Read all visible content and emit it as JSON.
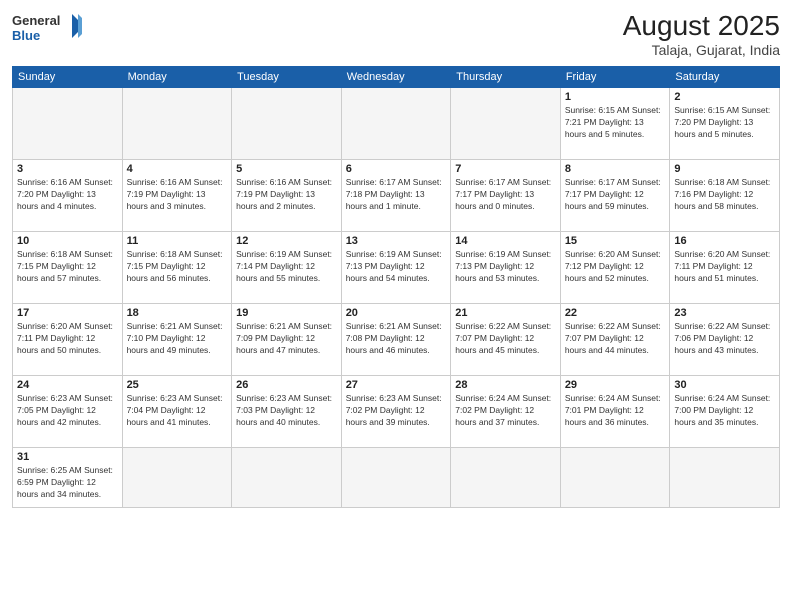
{
  "header": {
    "logo_general": "General",
    "logo_blue": "Blue",
    "month_year": "August 2025",
    "location": "Talaja, Gujarat, India"
  },
  "weekdays": [
    "Sunday",
    "Monday",
    "Tuesday",
    "Wednesday",
    "Thursday",
    "Friday",
    "Saturday"
  ],
  "weeks": [
    [
      {
        "day": "",
        "info": ""
      },
      {
        "day": "",
        "info": ""
      },
      {
        "day": "",
        "info": ""
      },
      {
        "day": "",
        "info": ""
      },
      {
        "day": "",
        "info": ""
      },
      {
        "day": "1",
        "info": "Sunrise: 6:15 AM\nSunset: 7:21 PM\nDaylight: 13 hours\nand 5 minutes."
      },
      {
        "day": "2",
        "info": "Sunrise: 6:15 AM\nSunset: 7:20 PM\nDaylight: 13 hours\nand 5 minutes."
      }
    ],
    [
      {
        "day": "3",
        "info": "Sunrise: 6:16 AM\nSunset: 7:20 PM\nDaylight: 13 hours\nand 4 minutes."
      },
      {
        "day": "4",
        "info": "Sunrise: 6:16 AM\nSunset: 7:19 PM\nDaylight: 13 hours\nand 3 minutes."
      },
      {
        "day": "5",
        "info": "Sunrise: 6:16 AM\nSunset: 7:19 PM\nDaylight: 13 hours\nand 2 minutes."
      },
      {
        "day": "6",
        "info": "Sunrise: 6:17 AM\nSunset: 7:18 PM\nDaylight: 13 hours\nand 1 minute."
      },
      {
        "day": "7",
        "info": "Sunrise: 6:17 AM\nSunset: 7:17 PM\nDaylight: 13 hours\nand 0 minutes."
      },
      {
        "day": "8",
        "info": "Sunrise: 6:17 AM\nSunset: 7:17 PM\nDaylight: 12 hours\nand 59 minutes."
      },
      {
        "day": "9",
        "info": "Sunrise: 6:18 AM\nSunset: 7:16 PM\nDaylight: 12 hours\nand 58 minutes."
      }
    ],
    [
      {
        "day": "10",
        "info": "Sunrise: 6:18 AM\nSunset: 7:15 PM\nDaylight: 12 hours\nand 57 minutes."
      },
      {
        "day": "11",
        "info": "Sunrise: 6:18 AM\nSunset: 7:15 PM\nDaylight: 12 hours\nand 56 minutes."
      },
      {
        "day": "12",
        "info": "Sunrise: 6:19 AM\nSunset: 7:14 PM\nDaylight: 12 hours\nand 55 minutes."
      },
      {
        "day": "13",
        "info": "Sunrise: 6:19 AM\nSunset: 7:13 PM\nDaylight: 12 hours\nand 54 minutes."
      },
      {
        "day": "14",
        "info": "Sunrise: 6:19 AM\nSunset: 7:13 PM\nDaylight: 12 hours\nand 53 minutes."
      },
      {
        "day": "15",
        "info": "Sunrise: 6:20 AM\nSunset: 7:12 PM\nDaylight: 12 hours\nand 52 minutes."
      },
      {
        "day": "16",
        "info": "Sunrise: 6:20 AM\nSunset: 7:11 PM\nDaylight: 12 hours\nand 51 minutes."
      }
    ],
    [
      {
        "day": "17",
        "info": "Sunrise: 6:20 AM\nSunset: 7:11 PM\nDaylight: 12 hours\nand 50 minutes."
      },
      {
        "day": "18",
        "info": "Sunrise: 6:21 AM\nSunset: 7:10 PM\nDaylight: 12 hours\nand 49 minutes."
      },
      {
        "day": "19",
        "info": "Sunrise: 6:21 AM\nSunset: 7:09 PM\nDaylight: 12 hours\nand 47 minutes."
      },
      {
        "day": "20",
        "info": "Sunrise: 6:21 AM\nSunset: 7:08 PM\nDaylight: 12 hours\nand 46 minutes."
      },
      {
        "day": "21",
        "info": "Sunrise: 6:22 AM\nSunset: 7:07 PM\nDaylight: 12 hours\nand 45 minutes."
      },
      {
        "day": "22",
        "info": "Sunrise: 6:22 AM\nSunset: 7:07 PM\nDaylight: 12 hours\nand 44 minutes."
      },
      {
        "day": "23",
        "info": "Sunrise: 6:22 AM\nSunset: 7:06 PM\nDaylight: 12 hours\nand 43 minutes."
      }
    ],
    [
      {
        "day": "24",
        "info": "Sunrise: 6:23 AM\nSunset: 7:05 PM\nDaylight: 12 hours\nand 42 minutes."
      },
      {
        "day": "25",
        "info": "Sunrise: 6:23 AM\nSunset: 7:04 PM\nDaylight: 12 hours\nand 41 minutes."
      },
      {
        "day": "26",
        "info": "Sunrise: 6:23 AM\nSunset: 7:03 PM\nDaylight: 12 hours\nand 40 minutes."
      },
      {
        "day": "27",
        "info": "Sunrise: 6:23 AM\nSunset: 7:02 PM\nDaylight: 12 hours\nand 39 minutes."
      },
      {
        "day": "28",
        "info": "Sunrise: 6:24 AM\nSunset: 7:02 PM\nDaylight: 12 hours\nand 37 minutes."
      },
      {
        "day": "29",
        "info": "Sunrise: 6:24 AM\nSunset: 7:01 PM\nDaylight: 12 hours\nand 36 minutes."
      },
      {
        "day": "30",
        "info": "Sunrise: 6:24 AM\nSunset: 7:00 PM\nDaylight: 12 hours\nand 35 minutes."
      }
    ],
    [
      {
        "day": "31",
        "info": "Sunrise: 6:25 AM\nSunset: 6:59 PM\nDaylight: 12 hours\nand 34 minutes."
      },
      {
        "day": "",
        "info": ""
      },
      {
        "day": "",
        "info": ""
      },
      {
        "day": "",
        "info": ""
      },
      {
        "day": "",
        "info": ""
      },
      {
        "day": "",
        "info": ""
      },
      {
        "day": "",
        "info": ""
      }
    ]
  ]
}
